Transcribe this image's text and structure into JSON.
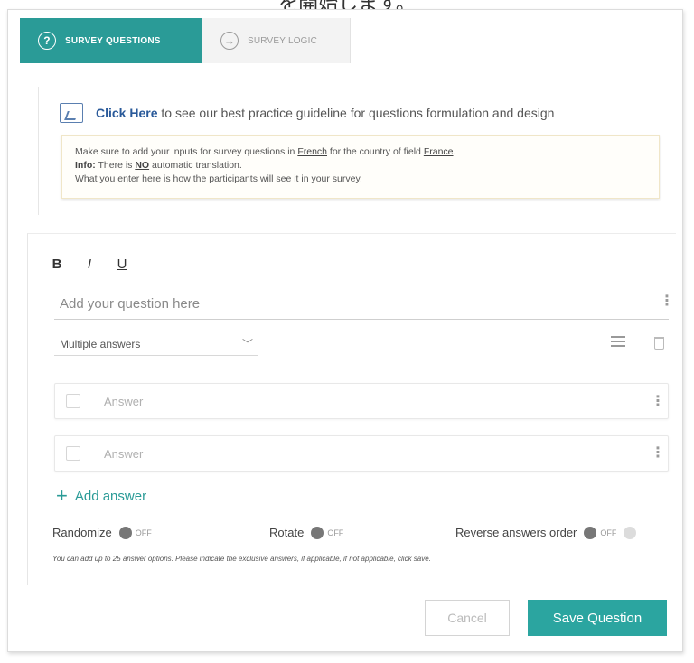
{
  "caption": "を開始します。",
  "tabs": [
    {
      "label": "SURVEY QUESTIONS",
      "icon": "question-circle-icon",
      "active": true
    },
    {
      "label": "SURVEY LOGIC",
      "icon": "arrow-circle-icon",
      "active": false
    }
  ],
  "guideline": {
    "link_label": "Click Here",
    "text": "to see our best practice guideline for questions formulation and design"
  },
  "note": {
    "line1_pre": "Make sure to add your inputs for survey questions in",
    "language": "French",
    "line1_mid": "for the country of field",
    "country": "France",
    "line1_end": ".",
    "info_label": "Info:",
    "line2_pre": "There is",
    "no_word": "NO",
    "line2_post": "automatic translation.",
    "line3": "What you enter here is how the participants will see it in your survey."
  },
  "format": {
    "bold": "B",
    "italic": "I",
    "underline": "U"
  },
  "question": {
    "placeholder": "Add your question here"
  },
  "answer_type": {
    "selected": "Multiple answers"
  },
  "answers": [
    {
      "placeholder": "Answer"
    },
    {
      "placeholder": "Answer"
    }
  ],
  "add_answer_label": "Add answer",
  "options": {
    "randomize_label": "Randomize",
    "rotate_label": "Rotate",
    "reverse_label": "Reverse answers order",
    "state_label": "OFF"
  },
  "hint": "You can add up to 25 answer options. Please indicate the exclusive answers, if applicable, if not applicable, click save.",
  "buttons": {
    "cancel": "Cancel",
    "save": "Save Question"
  },
  "colors": {
    "accent": "#2a9b97",
    "link": "#2a5a9a"
  }
}
